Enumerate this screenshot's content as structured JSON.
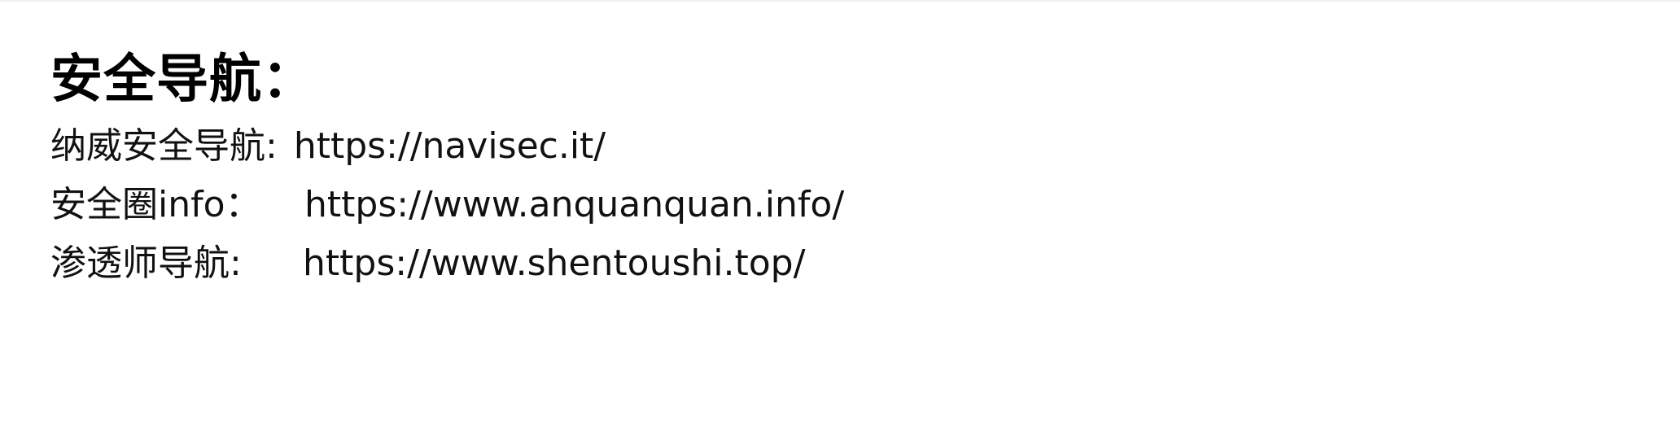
{
  "heading": "安全导航：",
  "links": [
    {
      "label": "纳威安全导航:",
      "url": "https://navisec.it/"
    },
    {
      "label": "安全圈info：",
      "url": "https://www.anquanquan.info/"
    },
    {
      "label": "渗透师导航:",
      "url": "https://www.shentoushi.top/"
    }
  ]
}
